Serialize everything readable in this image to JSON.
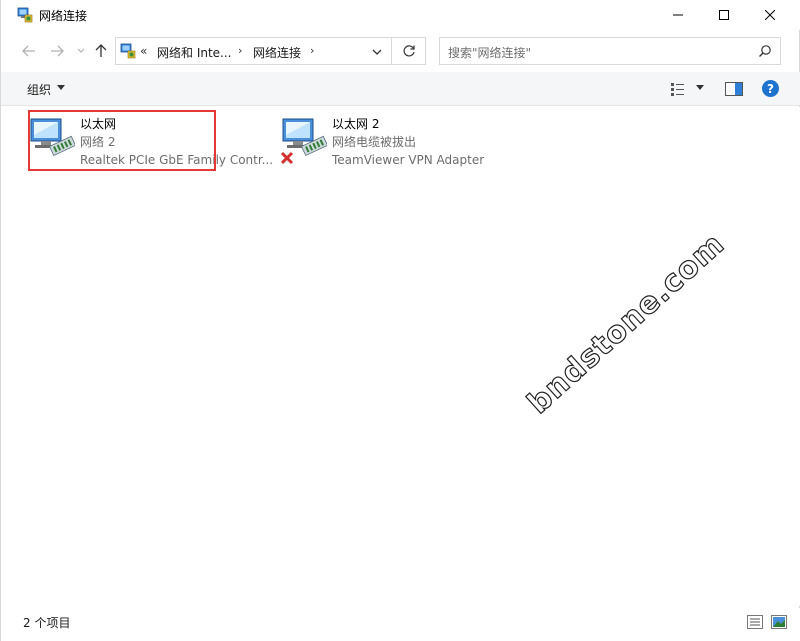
{
  "window": {
    "title": "网络连接",
    "icons": {
      "app": "network-connections-icon",
      "minimize": "minimize-icon",
      "maximize": "maximize-icon",
      "close": "close-icon"
    }
  },
  "nav": {
    "back_icon": "back-arrow-icon",
    "forward_icon": "forward-arrow-icon",
    "recent_icon": "chevron-down-icon",
    "up_icon": "up-arrow-icon"
  },
  "address": {
    "overflow": "«",
    "crumbs": [
      "网络和 Inte...",
      "网络连接"
    ],
    "separator": "›",
    "refresh_icon": "refresh-icon"
  },
  "search": {
    "placeholder": "搜索\"网络连接\"",
    "icon": "search-icon"
  },
  "toolbar": {
    "organize_label": "组织",
    "view_icon": "change-view-icon",
    "preview_icon": "preview-pane-icon",
    "help_label": "?"
  },
  "items": [
    {
      "name": "以太网",
      "network": "网络 2",
      "adapter": "Realtek PCIe GbE Family Contr...",
      "status_icon": "network-adapter-icon",
      "disconnected": false
    },
    {
      "name": "以太网 2",
      "network": "网络电缆被拔出",
      "adapter": "TeamViewer VPN Adapter",
      "status_icon": "network-adapter-disconnected-icon",
      "disconnected": true
    }
  ],
  "watermark": "bndstone.com",
  "status": {
    "count_text": "2 个项目"
  },
  "colors": {
    "accent": "#1e73cf",
    "highlight": "#e53935",
    "error": "#d32f2f"
  }
}
